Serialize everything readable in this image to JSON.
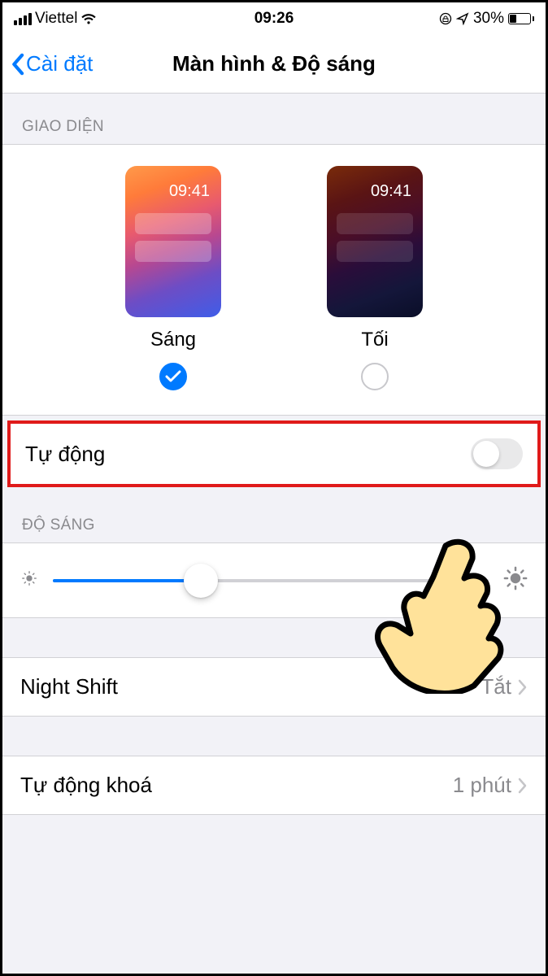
{
  "statusBar": {
    "carrier": "Viettel",
    "time": "09:26",
    "batteryPercent": "30%"
  },
  "nav": {
    "back": "Cài đặt",
    "title": "Màn hình & Độ sáng"
  },
  "sections": {
    "appearanceHeader": "GIAO DIỆN",
    "brightnessHeader": "ĐỘ SÁNG"
  },
  "appearance": {
    "light": {
      "label": "Sáng",
      "previewTime": "09:41",
      "selected": true
    },
    "dark": {
      "label": "Tối",
      "previewTime": "09:41",
      "selected": false
    }
  },
  "autoRow": {
    "label": "Tự động",
    "enabled": false
  },
  "brightness": {
    "valuePercent": 34
  },
  "rows": {
    "nightShift": {
      "label": "Night Shift",
      "value": "Tắt"
    },
    "autoLock": {
      "label": "Tự động khoá",
      "value": "1 phút"
    }
  },
  "colors": {
    "accent": "#007aff",
    "highlightBorder": "#e01a1a"
  }
}
